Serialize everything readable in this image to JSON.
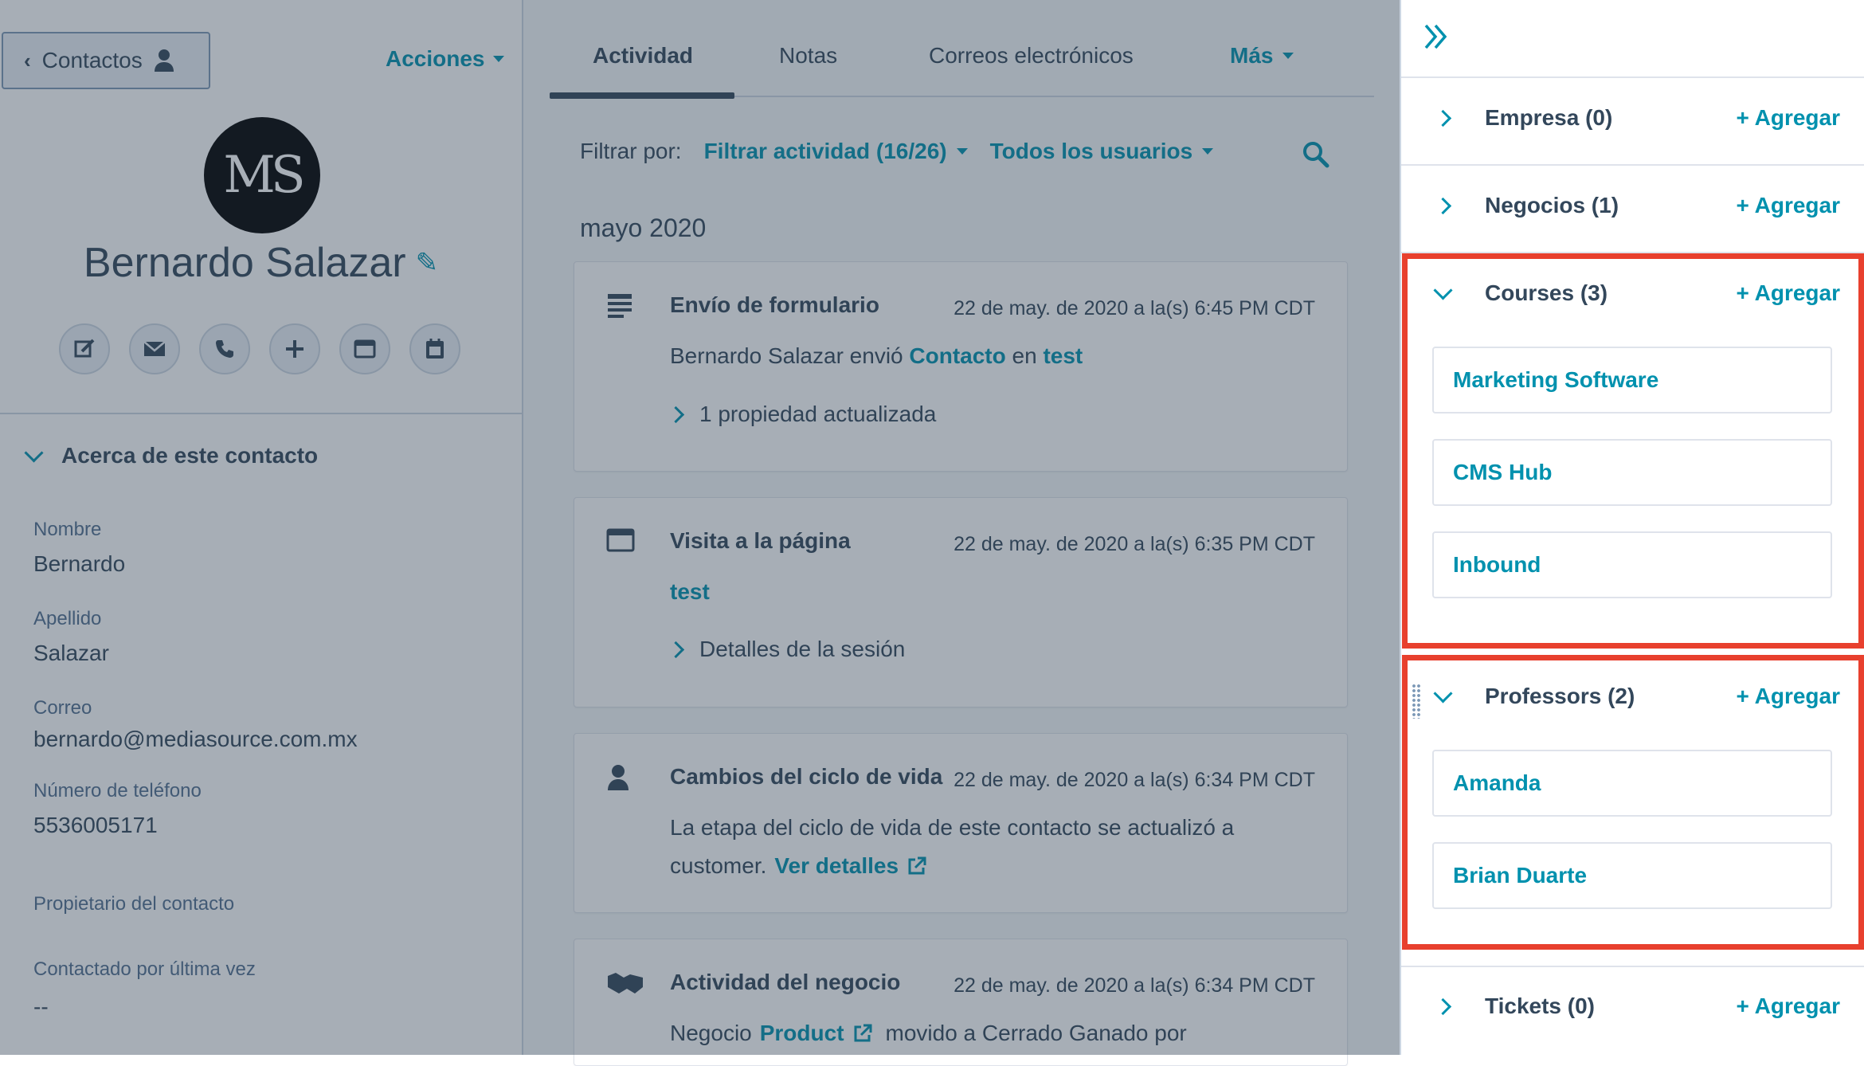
{
  "left": {
    "back_label": "Contactos",
    "actions_label": "Acciones",
    "avatar_initials": "MS",
    "contact_name": "Bernardo Salazar",
    "action_icons": [
      "note-icon",
      "email-icon",
      "call-icon",
      "add-icon",
      "meeting-icon",
      "schedule-icon"
    ],
    "about_header": "Acerca de este contacto",
    "properties": [
      {
        "label": "Nombre",
        "value": "Bernardo"
      },
      {
        "label": "Apellido",
        "value": "Salazar"
      },
      {
        "label": "Correo",
        "value": "bernardo@mediasource.com.mx"
      },
      {
        "label": "Número de teléfono",
        "value": "5536005171"
      },
      {
        "label": "Propietario del contacto",
        "value": ""
      },
      {
        "label": "Contactado por última vez",
        "value": "--"
      }
    ]
  },
  "middle": {
    "tabs": [
      "Actividad",
      "Notas",
      "Correos electrónicos",
      "Más"
    ],
    "filter_label": "Filtrar por:",
    "filter_activity": "Filtrar actividad (16/26)",
    "filter_users": "Todos los usuarios",
    "month": "mayo 2020",
    "cards": [
      {
        "title": "Envío de formulario",
        "time": "22 de may. de 2020 a la(s) 6:45 PM CDT",
        "text_pre": "Bernardo Salazar envió",
        "link1": "Contacto",
        "text_mid": "en",
        "link2": "test",
        "expander": "1 propiedad actualizada"
      },
      {
        "title": "Visita a la página",
        "time": "22 de may. de 2020 a la(s) 6:35 PM CDT",
        "link": "test",
        "expander": "Detalles de la sesión"
      },
      {
        "title": "Cambios del ciclo de vida",
        "time": "22 de may. de 2020 a la(s) 6:34 PM CDT",
        "line1": "La etapa del ciclo de vida de este contacto se actualizó a",
        "line2_pre": "customer.",
        "link": "Ver detalles"
      },
      {
        "title": "Actividad del negocio",
        "time": "22 de may. de 2020 a la(s) 6:34 PM CDT",
        "text_pre": "Negocio",
        "link": "Product",
        "text_post": "movido a Cerrado Ganado por"
      }
    ]
  },
  "right": {
    "add_label": "+ Agregar",
    "sections": [
      {
        "title": "Empresa (0)",
        "expanded": false
      },
      {
        "title": "Negocios (1)",
        "expanded": false
      },
      {
        "title": "Courses (3)",
        "expanded": true,
        "items": [
          "Marketing Software",
          "CMS Hub",
          "Inbound"
        ]
      },
      {
        "title": "Professors (2)",
        "expanded": true,
        "items": [
          "Amanda",
          "Brian Duarte"
        ]
      },
      {
        "title": "Tickets (0)",
        "expanded": false
      }
    ],
    "highlight_color": "#e8402e"
  },
  "colors": {
    "accent": "#0091ae",
    "text": "#33475b",
    "overlay": "rgba(45,62,80,0.42)"
  }
}
